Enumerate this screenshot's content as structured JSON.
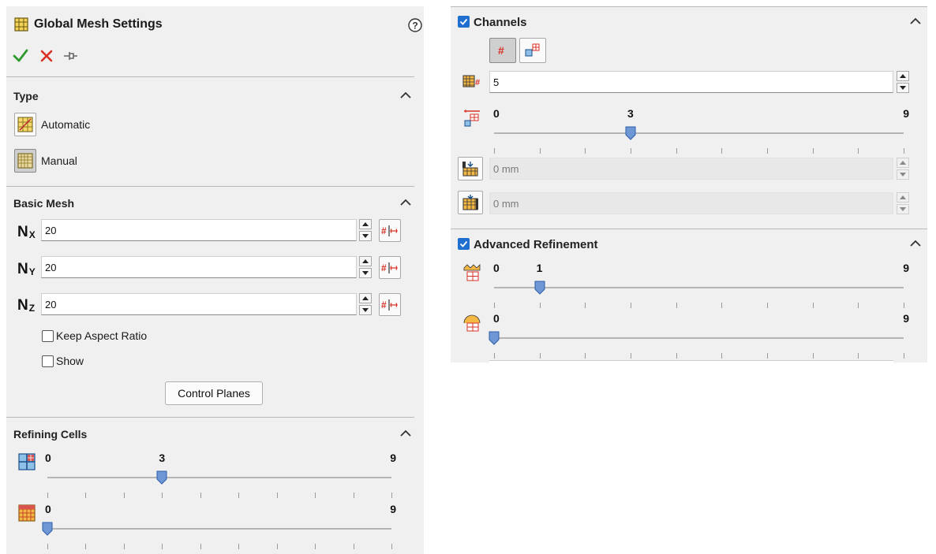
{
  "left": {
    "title": "Global Mesh Settings",
    "help_icon": "help-icon",
    "actions": {
      "ok": "checkmark-icon",
      "cancel": "cancel-icon",
      "pin": "pin-icon"
    },
    "type": {
      "title": "Type",
      "options": [
        {
          "label": "Automatic",
          "icon": "automatic-mesh-icon",
          "selected": false
        },
        {
          "label": "Manual",
          "icon": "manual-mesh-icon",
          "selected": true
        }
      ]
    },
    "basic_mesh": {
      "title": "Basic Mesh",
      "fields": [
        {
          "symbol": "N",
          "sub": "X",
          "value": "20"
        },
        {
          "symbol": "N",
          "sub": "Y",
          "value": "20"
        },
        {
          "symbol": "N",
          "sub": "Z",
          "value": "20"
        }
      ],
      "keep_aspect_ratio": {
        "label": "Keep Aspect Ratio",
        "checked": false
      },
      "show": {
        "label": "Show",
        "checked": false
      },
      "control_planes_label": "Control Planes"
    },
    "refining_cells": {
      "title": "Refining Cells",
      "sliders": [
        {
          "icon": "refine-fluid-cells-icon",
          "min": "0",
          "max": "9",
          "value": 3,
          "value_label": "3"
        },
        {
          "icon": "refine-partial-cells-icon",
          "min": "0",
          "max": "9",
          "value": 0,
          "value_label": ""
        }
      ]
    }
  },
  "right": {
    "channels": {
      "title": "Channels",
      "checked": true,
      "mode_buttons": [
        {
          "icon": "cells-count-icon",
          "pressed": true
        },
        {
          "icon": "cell-size-icon",
          "pressed": false
        }
      ],
      "cells_across": "5",
      "slider": {
        "min": "0",
        "max": "9",
        "value": 3,
        "value_label": "3"
      },
      "min_height": {
        "value": "0 mm"
      },
      "max_height": {
        "value": "0 mm"
      }
    },
    "advanced_refinement": {
      "title": "Advanced Refinement",
      "checked": true,
      "sliders": [
        {
          "icon": "small-solid-features-icon",
          "min": "0",
          "max": "9",
          "value": 1,
          "value_label": "1"
        },
        {
          "icon": "curvature-refinement-icon",
          "min": "0",
          "max": "9",
          "value": 0,
          "value_label": ""
        }
      ]
    }
  },
  "colors": {
    "accent": "#1f6fd0",
    "ok": "#2e9a2e",
    "cancel": "#d93025",
    "thumb": "#6f97d6"
  }
}
